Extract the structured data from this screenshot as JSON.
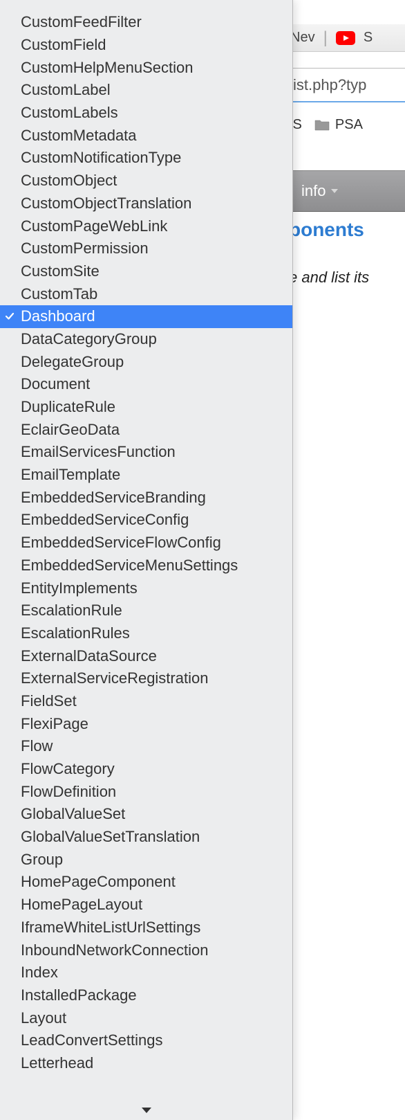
{
  "browser": {
    "tab_text": "Nev",
    "tab_letter_after": "S",
    "url_fragment": "ist.php?typ"
  },
  "bookmarks": {
    "item1": "/S",
    "item2": "PSA"
  },
  "toolbar": {
    "info_label": "info"
  },
  "content": {
    "heading_fragment": "ponents",
    "italic_fragment": "e and list its"
  },
  "dropdown": {
    "selected_index": 13,
    "items": [
      "CustomFeedFilter",
      "CustomField",
      "CustomHelpMenuSection",
      "CustomLabel",
      "CustomLabels",
      "CustomMetadata",
      "CustomNotificationType",
      "CustomObject",
      "CustomObjectTranslation",
      "CustomPageWebLink",
      "CustomPermission",
      "CustomSite",
      "CustomTab",
      "Dashboard",
      "DataCategoryGroup",
      "DelegateGroup",
      "Document",
      "DuplicateRule",
      "EclairGeoData",
      "EmailServicesFunction",
      "EmailTemplate",
      "EmbeddedServiceBranding",
      "EmbeddedServiceConfig",
      "EmbeddedServiceFlowConfig",
      "EmbeddedServiceMenuSettings",
      "EntityImplements",
      "EscalationRule",
      "EscalationRules",
      "ExternalDataSource",
      "ExternalServiceRegistration",
      "FieldSet",
      "FlexiPage",
      "Flow",
      "FlowCategory",
      "FlowDefinition",
      "GlobalValueSet",
      "GlobalValueSetTranslation",
      "Group",
      "HomePageComponent",
      "HomePageLayout",
      "IframeWhiteListUrlSettings",
      "InboundNetworkConnection",
      "Index",
      "InstalledPackage",
      "Layout",
      "LeadConvertSettings",
      "Letterhead"
    ]
  }
}
